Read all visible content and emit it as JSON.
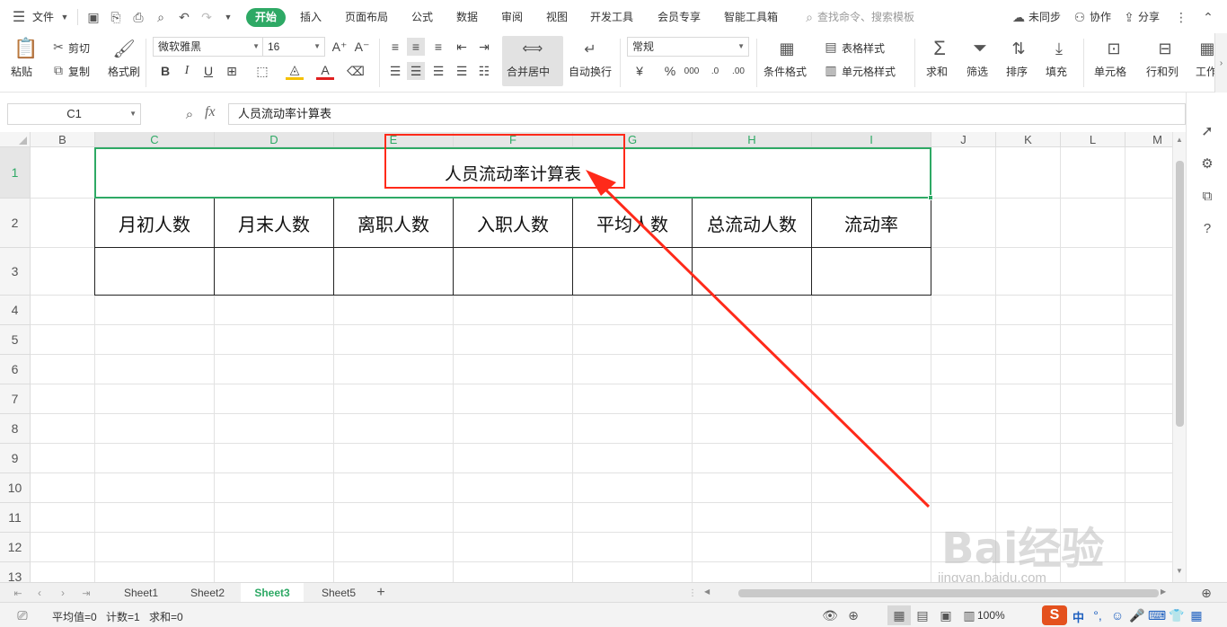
{
  "menubar": {
    "file": "文件",
    "tabs": [
      "开始",
      "插入",
      "页面布局",
      "公式",
      "数据",
      "审阅",
      "视图",
      "开发工具",
      "会员专享",
      "智能工具箱"
    ],
    "search_placeholder": "查找命令、搜索模板",
    "sync": "未同步",
    "collab": "协作",
    "share": "分享"
  },
  "ribbon": {
    "paste": "粘贴",
    "cut": "剪切",
    "copy": "复制",
    "format_painter": "格式刷",
    "font_name": "微软雅黑",
    "font_size": "16",
    "merge_center": "合并居中",
    "wrap_text": "自动换行",
    "number_format": "常规",
    "conditional_format": "条件格式",
    "table_style": "表格样式",
    "cell_style": "单元格样式",
    "sum": "求和",
    "filter": "筛选",
    "sort": "排序",
    "fill": "填充",
    "cell": "单元格",
    "row_col": "行和列",
    "worksheet": "工作"
  },
  "formula_bar": {
    "name_box": "C1",
    "fx": "fx",
    "content": "人员流动率计算表"
  },
  "grid": {
    "columns": [
      "B",
      "C",
      "D",
      "E",
      "F",
      "G",
      "H",
      "I",
      "J",
      "K",
      "L",
      "M"
    ],
    "rows": [
      "1",
      "2",
      "3",
      "4",
      "5",
      "6",
      "7",
      "8",
      "9",
      "10",
      "11",
      "12",
      "13"
    ],
    "title": "人员流动率计算表",
    "headers": [
      "月初人数",
      "月末人数",
      "离职人数",
      "入职人数",
      "平均人数",
      "总流动人数",
      "流动率"
    ]
  },
  "sheets": [
    "Sheet1",
    "Sheet2",
    "Sheet3",
    "Sheet5"
  ],
  "active_sheet": "Sheet3",
  "status": {
    "average": "平均值=0",
    "count": "计数=1",
    "sum": "求和=0",
    "zoom": "100%",
    "ime": "中"
  },
  "watermark": {
    "text": "Bai经验",
    "url": "jingyan.baidu.com"
  },
  "colors": {
    "accent": "#2ea965",
    "annotation": "#ff2a1a"
  }
}
